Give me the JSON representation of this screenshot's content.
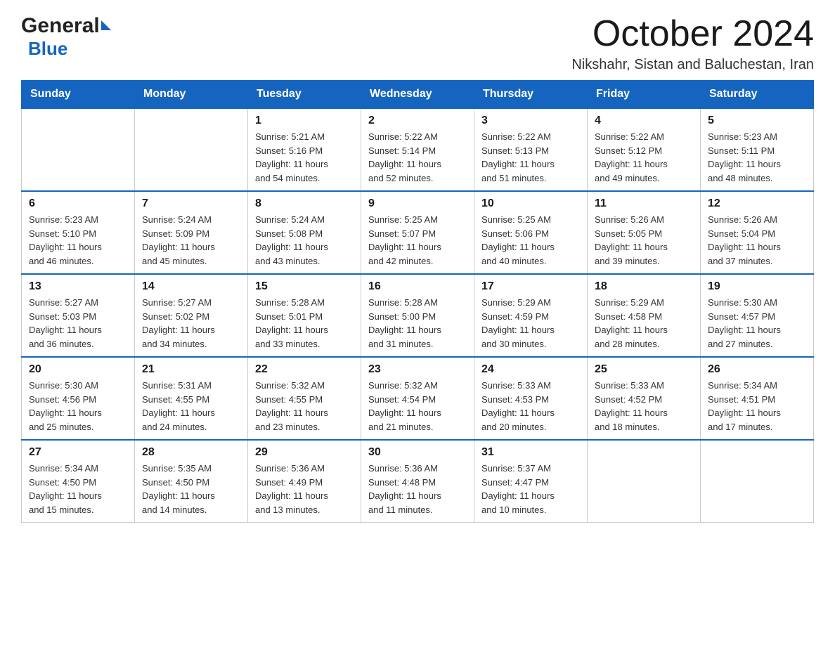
{
  "logo": {
    "general": "General",
    "blue": "Blue"
  },
  "title": "October 2024",
  "location": "Nikshahr, Sistan and Baluchestan, Iran",
  "weekdays": [
    "Sunday",
    "Monday",
    "Tuesday",
    "Wednesday",
    "Thursday",
    "Friday",
    "Saturday"
  ],
  "weeks": [
    [
      {
        "day": "",
        "info": ""
      },
      {
        "day": "",
        "info": ""
      },
      {
        "day": "1",
        "info": "Sunrise: 5:21 AM\nSunset: 5:16 PM\nDaylight: 11 hours\nand 54 minutes."
      },
      {
        "day": "2",
        "info": "Sunrise: 5:22 AM\nSunset: 5:14 PM\nDaylight: 11 hours\nand 52 minutes."
      },
      {
        "day": "3",
        "info": "Sunrise: 5:22 AM\nSunset: 5:13 PM\nDaylight: 11 hours\nand 51 minutes."
      },
      {
        "day": "4",
        "info": "Sunrise: 5:22 AM\nSunset: 5:12 PM\nDaylight: 11 hours\nand 49 minutes."
      },
      {
        "day": "5",
        "info": "Sunrise: 5:23 AM\nSunset: 5:11 PM\nDaylight: 11 hours\nand 48 minutes."
      }
    ],
    [
      {
        "day": "6",
        "info": "Sunrise: 5:23 AM\nSunset: 5:10 PM\nDaylight: 11 hours\nand 46 minutes."
      },
      {
        "day": "7",
        "info": "Sunrise: 5:24 AM\nSunset: 5:09 PM\nDaylight: 11 hours\nand 45 minutes."
      },
      {
        "day": "8",
        "info": "Sunrise: 5:24 AM\nSunset: 5:08 PM\nDaylight: 11 hours\nand 43 minutes."
      },
      {
        "day": "9",
        "info": "Sunrise: 5:25 AM\nSunset: 5:07 PM\nDaylight: 11 hours\nand 42 minutes."
      },
      {
        "day": "10",
        "info": "Sunrise: 5:25 AM\nSunset: 5:06 PM\nDaylight: 11 hours\nand 40 minutes."
      },
      {
        "day": "11",
        "info": "Sunrise: 5:26 AM\nSunset: 5:05 PM\nDaylight: 11 hours\nand 39 minutes."
      },
      {
        "day": "12",
        "info": "Sunrise: 5:26 AM\nSunset: 5:04 PM\nDaylight: 11 hours\nand 37 minutes."
      }
    ],
    [
      {
        "day": "13",
        "info": "Sunrise: 5:27 AM\nSunset: 5:03 PM\nDaylight: 11 hours\nand 36 minutes."
      },
      {
        "day": "14",
        "info": "Sunrise: 5:27 AM\nSunset: 5:02 PM\nDaylight: 11 hours\nand 34 minutes."
      },
      {
        "day": "15",
        "info": "Sunrise: 5:28 AM\nSunset: 5:01 PM\nDaylight: 11 hours\nand 33 minutes."
      },
      {
        "day": "16",
        "info": "Sunrise: 5:28 AM\nSunset: 5:00 PM\nDaylight: 11 hours\nand 31 minutes."
      },
      {
        "day": "17",
        "info": "Sunrise: 5:29 AM\nSunset: 4:59 PM\nDaylight: 11 hours\nand 30 minutes."
      },
      {
        "day": "18",
        "info": "Sunrise: 5:29 AM\nSunset: 4:58 PM\nDaylight: 11 hours\nand 28 minutes."
      },
      {
        "day": "19",
        "info": "Sunrise: 5:30 AM\nSunset: 4:57 PM\nDaylight: 11 hours\nand 27 minutes."
      }
    ],
    [
      {
        "day": "20",
        "info": "Sunrise: 5:30 AM\nSunset: 4:56 PM\nDaylight: 11 hours\nand 25 minutes."
      },
      {
        "day": "21",
        "info": "Sunrise: 5:31 AM\nSunset: 4:55 PM\nDaylight: 11 hours\nand 24 minutes."
      },
      {
        "day": "22",
        "info": "Sunrise: 5:32 AM\nSunset: 4:55 PM\nDaylight: 11 hours\nand 23 minutes."
      },
      {
        "day": "23",
        "info": "Sunrise: 5:32 AM\nSunset: 4:54 PM\nDaylight: 11 hours\nand 21 minutes."
      },
      {
        "day": "24",
        "info": "Sunrise: 5:33 AM\nSunset: 4:53 PM\nDaylight: 11 hours\nand 20 minutes."
      },
      {
        "day": "25",
        "info": "Sunrise: 5:33 AM\nSunset: 4:52 PM\nDaylight: 11 hours\nand 18 minutes."
      },
      {
        "day": "26",
        "info": "Sunrise: 5:34 AM\nSunset: 4:51 PM\nDaylight: 11 hours\nand 17 minutes."
      }
    ],
    [
      {
        "day": "27",
        "info": "Sunrise: 5:34 AM\nSunset: 4:50 PM\nDaylight: 11 hours\nand 15 minutes."
      },
      {
        "day": "28",
        "info": "Sunrise: 5:35 AM\nSunset: 4:50 PM\nDaylight: 11 hours\nand 14 minutes."
      },
      {
        "day": "29",
        "info": "Sunrise: 5:36 AM\nSunset: 4:49 PM\nDaylight: 11 hours\nand 13 minutes."
      },
      {
        "day": "30",
        "info": "Sunrise: 5:36 AM\nSunset: 4:48 PM\nDaylight: 11 hours\nand 11 minutes."
      },
      {
        "day": "31",
        "info": "Sunrise: 5:37 AM\nSunset: 4:47 PM\nDaylight: 11 hours\nand 10 minutes."
      },
      {
        "day": "",
        "info": ""
      },
      {
        "day": "",
        "info": ""
      }
    ]
  ]
}
